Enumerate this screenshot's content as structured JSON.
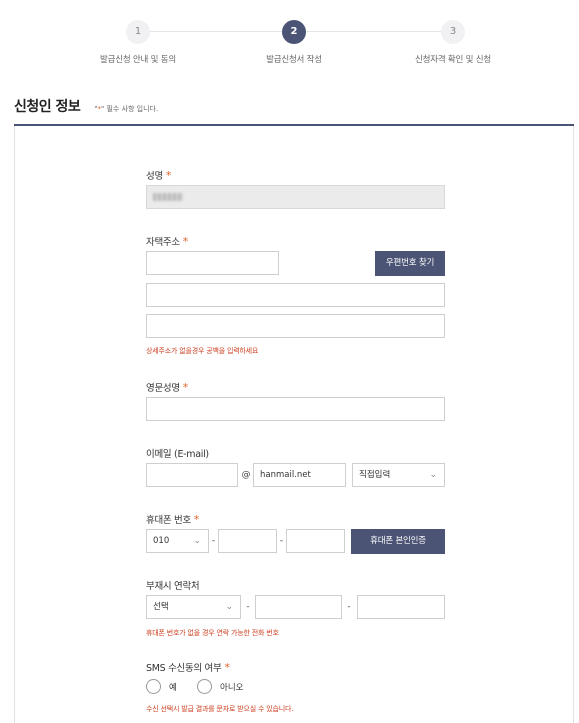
{
  "stepper": {
    "steps": [
      {
        "number": "1",
        "label": "발급신청 안내 및 동의"
      },
      {
        "number": "2",
        "label": "발급신청서 작성"
      },
      {
        "number": "3",
        "label": "신청자격 확인 및 신청"
      }
    ]
  },
  "section": {
    "title": "신청인 정보",
    "note_open": "\"",
    "note_star": "*",
    "note_rest": "\" 필수 사항 입니다."
  },
  "required_mark": "*",
  "form": {
    "name": {
      "label": "성명"
    },
    "address": {
      "label": "자택주소",
      "zip_button": "우편번호 찾기",
      "help": "상세주소가 없을경우 공백을 입력하세요"
    },
    "english_name": {
      "label": "영문성명"
    },
    "email": {
      "label": "이메일 (E-mail)",
      "at": "@",
      "domain_value": "hanmail.net",
      "domain_select": "직접입력"
    },
    "mobile": {
      "label": "휴대폰 번호",
      "prefix": "010",
      "dash": "-",
      "verify_button": "휴대폰 본인인증"
    },
    "alt_contact": {
      "label": "부재시 연락처",
      "select": "선택",
      "dash": "-",
      "help": "휴대폰 번호가 없을 경우 연락 가능한 전화 번호"
    },
    "sms": {
      "label": "SMS 수신동의 여부",
      "yes": "예",
      "no": "아니오",
      "help": "수신 선택시 발급 결과를 문자로 받으실 수 있습니다."
    }
  },
  "icons": {
    "chevron": "chevron-down-icon"
  },
  "colors": {
    "accent": "#4b5474",
    "required": "#e0632a",
    "help": "#cc3d1e"
  }
}
